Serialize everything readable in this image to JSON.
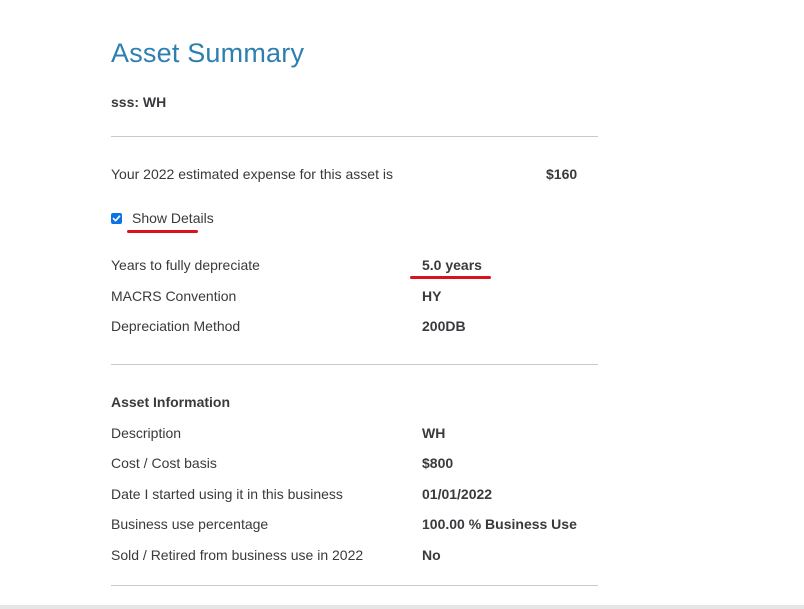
{
  "header": {
    "title": "Asset Summary",
    "asset_name": "sss: WH"
  },
  "expense": {
    "label": "Your 2022 estimated expense for this asset is",
    "value": "$160"
  },
  "details_toggle": {
    "label": "Show Details",
    "checked": true
  },
  "details": [
    {
      "label": "Years to fully depreciate",
      "value": "5.0 years"
    },
    {
      "label": "MACRS Convention",
      "value": "HY"
    },
    {
      "label": "Depreciation Method",
      "value": "200DB"
    }
  ],
  "asset_information": {
    "heading": "Asset Information",
    "rows": [
      {
        "label": "Description",
        "value": "WH"
      },
      {
        "label": "Cost / Cost basis",
        "value": "$800"
      },
      {
        "label": "Date I started using it in this business",
        "value": "01/01/2022"
      },
      {
        "label": "Business use percentage",
        "value": "100.00 % Business Use"
      },
      {
        "label": "Sold / Retired from business use in 2022",
        "value": "No"
      }
    ]
  },
  "colors": {
    "title": "#2c7fb0",
    "text": "#393a3d",
    "checkbox": "#0b74e5",
    "annotation_underline": "#d9121b",
    "divider": "#c9cacc"
  }
}
